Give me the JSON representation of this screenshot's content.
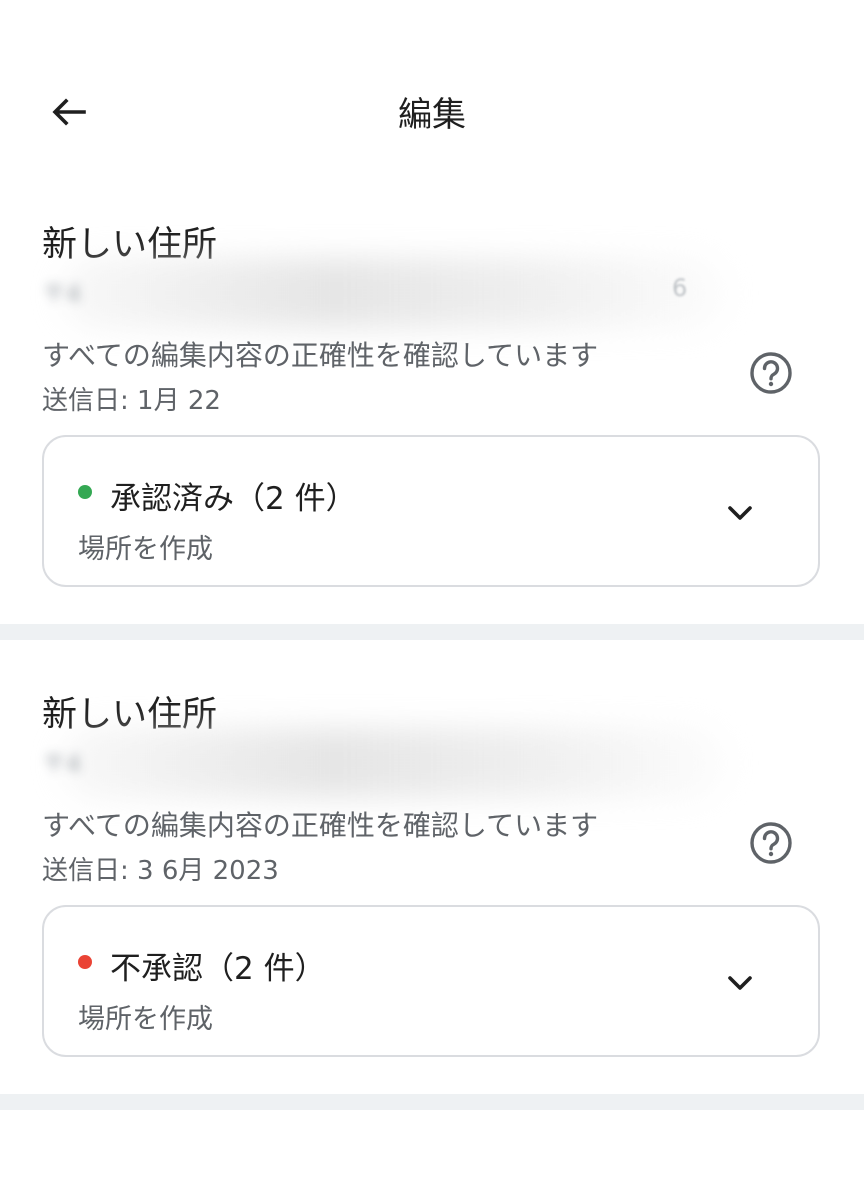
{
  "header": {
    "title": "編集",
    "back_icon": "arrow-back-icon"
  },
  "edits": [
    {
      "title": "新しい住所",
      "address_blurred": "〒4",
      "address_tail": "6",
      "reviewing_text": "すべての編集内容の正確性を確認しています",
      "sent_date": "送信日: 1月 22",
      "status": {
        "label": "承認済み（2 件）",
        "subtitle": "場所を作成",
        "color": "#34a853"
      }
    },
    {
      "title": "新しい住所",
      "address_blurred": "〒4",
      "address_tail": "",
      "reviewing_text": "すべての編集内容の正確性を確認しています",
      "sent_date": "送信日: 3 6月 2023",
      "status": {
        "label": "不承認（2 件）",
        "subtitle": "場所を作成",
        "color": "#ea4335"
      }
    }
  ],
  "colors": {
    "divider": "#eef1f3",
    "border": "#dadce0",
    "approved": "#34a853",
    "rejected": "#ea4335"
  }
}
